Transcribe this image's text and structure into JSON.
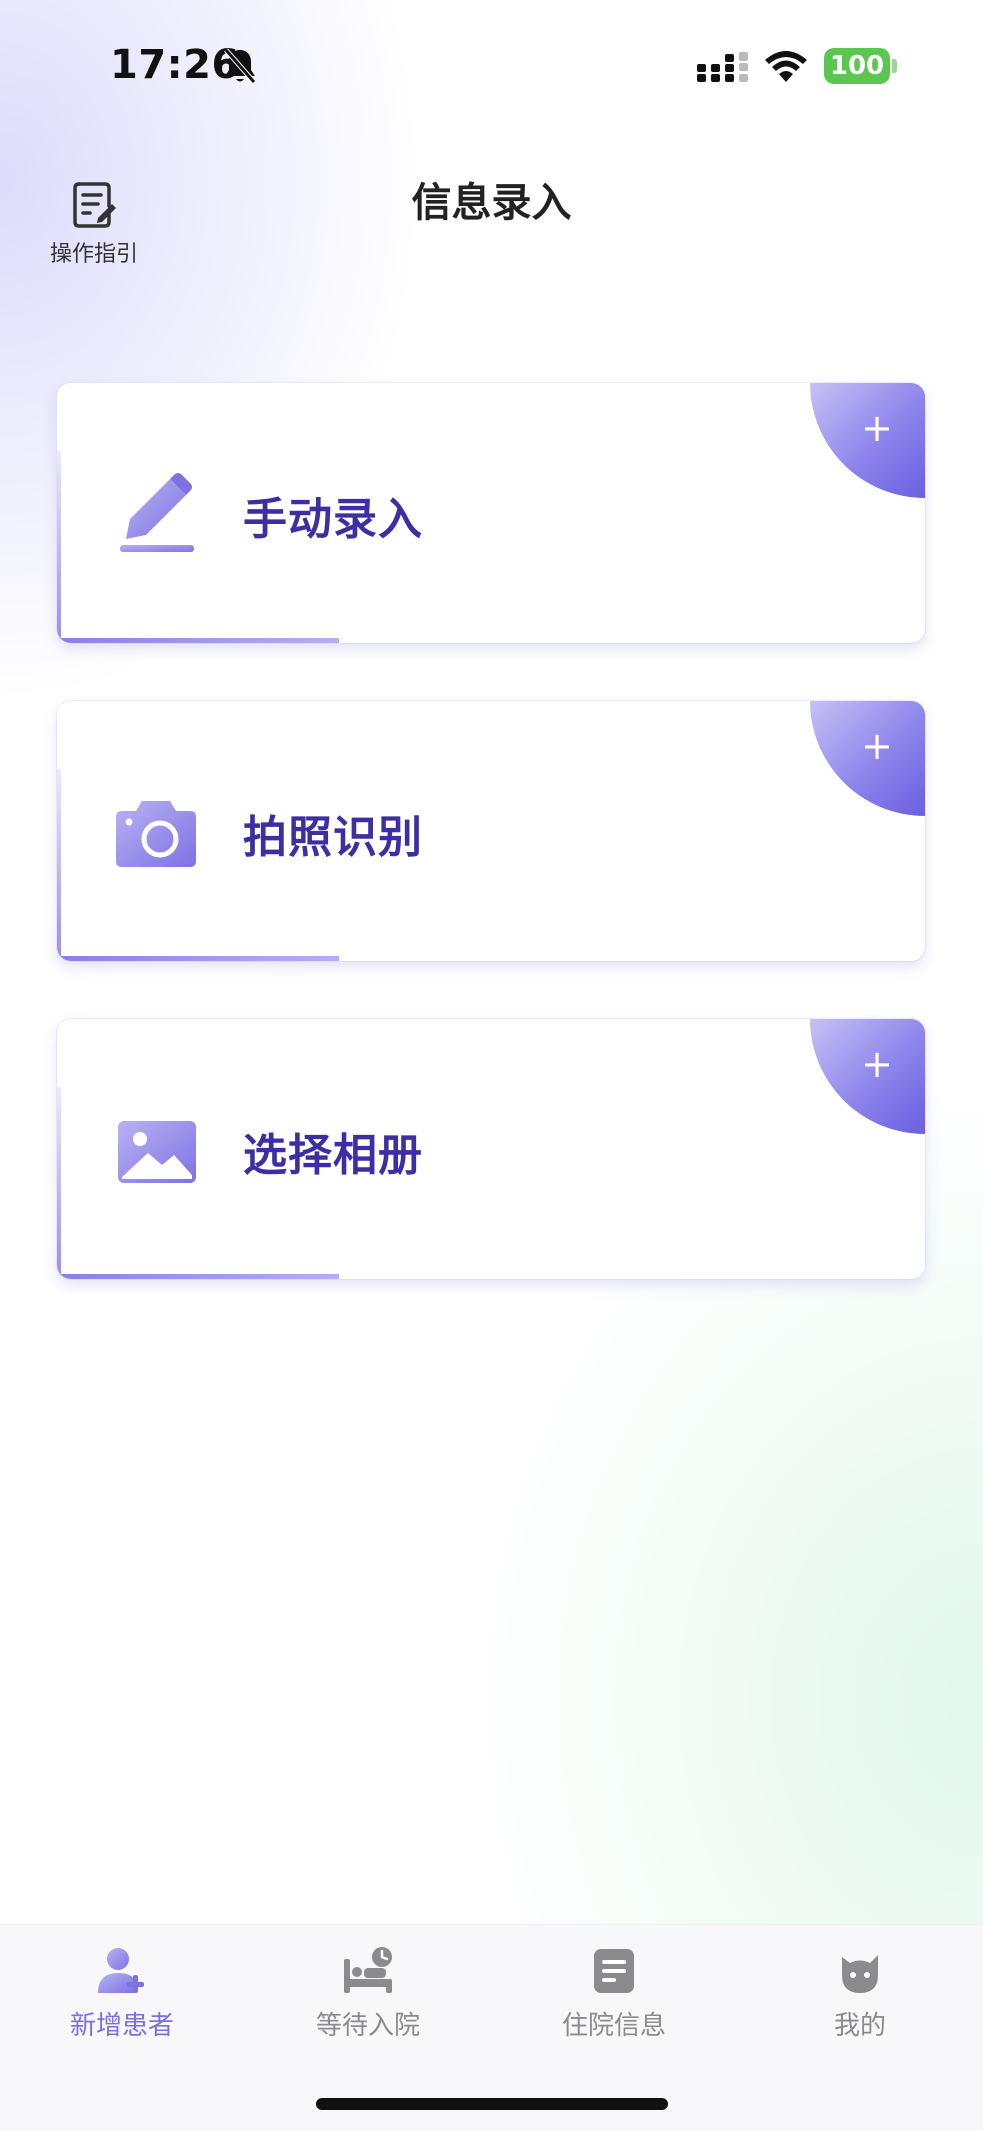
{
  "status_bar": {
    "time": "17:26",
    "battery": "100",
    "icons": [
      "bell-slash-icon",
      "signal-icon",
      "wifi-icon",
      "battery-icon"
    ],
    "battery_color": "#5ac84f"
  },
  "header": {
    "title": "信息录入",
    "guide_label": "操作指引",
    "guide_icon": "document-edit-icon"
  },
  "cards": [
    {
      "label": "手动录入",
      "icon": "pencil-icon",
      "action_icon": "plus-icon",
      "action_symbol": "+"
    },
    {
      "label": "拍照识别",
      "icon": "camera-icon",
      "action_icon": "plus-icon",
      "action_symbol": "+"
    },
    {
      "label": "选择相册",
      "icon": "picture-icon",
      "action_icon": "plus-icon",
      "action_symbol": "+"
    }
  ],
  "tabbar": {
    "tabs": [
      {
        "label": "新增患者",
        "icon": "add-user-icon",
        "active": true
      },
      {
        "label": "等待入院",
        "icon": "bed-clock-icon",
        "active": false
      },
      {
        "label": "住院信息",
        "icon": "list-doc-icon",
        "active": false
      },
      {
        "label": "我的",
        "icon": "cat-face-icon",
        "active": false
      }
    ]
  },
  "colors": {
    "accent": "#7b70de",
    "card_text": "#3d2fa3",
    "inactive_tab": "#8b8b8f"
  }
}
